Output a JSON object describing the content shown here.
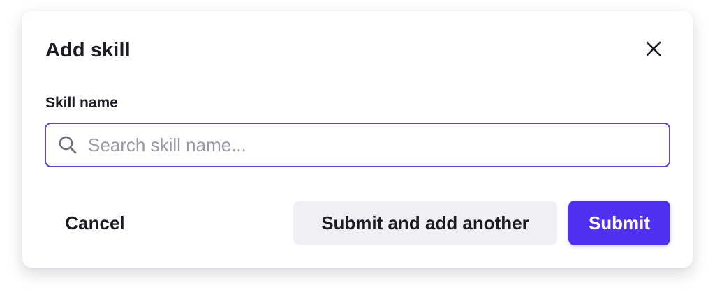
{
  "dialog": {
    "title": "Add skill",
    "close_icon": "close-icon"
  },
  "field": {
    "label": "Skill name",
    "value": "",
    "placeholder": "Search skill name...",
    "icon": "search-icon"
  },
  "actions": {
    "cancel_label": "Cancel",
    "submit_another_label": "Submit and add another",
    "submit_label": "Submit"
  },
  "colors": {
    "accent": "#4f2ff0",
    "focus_border": "#5a3ff0",
    "secondary_bg": "#efeff4",
    "text": "#1c1b22",
    "placeholder": "#9a98a4"
  }
}
